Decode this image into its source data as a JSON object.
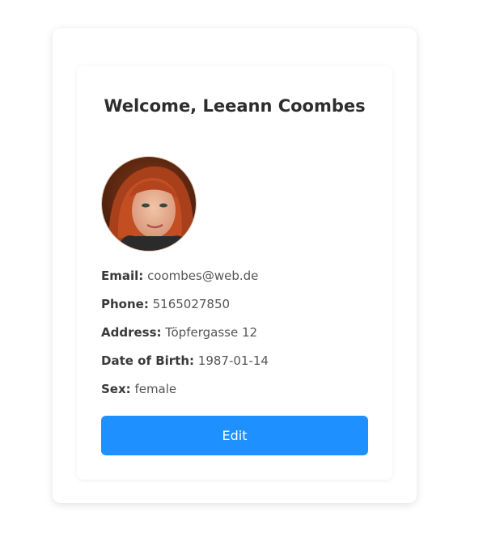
{
  "profile": {
    "title": "Welcome, Leeann Coombes",
    "fields": [
      {
        "label": "Email:",
        "value": "coombes@web.de"
      },
      {
        "label": "Phone:",
        "value": "5165027850"
      },
      {
        "label": "Address:",
        "value": "Töpfergasse 12"
      },
      {
        "label": "Date of Birth:",
        "value": "1987-01-14"
      },
      {
        "label": "Sex:",
        "value": "female"
      }
    ],
    "edit_label": "Edit"
  },
  "colors": {
    "accent": "#1e90ff"
  }
}
